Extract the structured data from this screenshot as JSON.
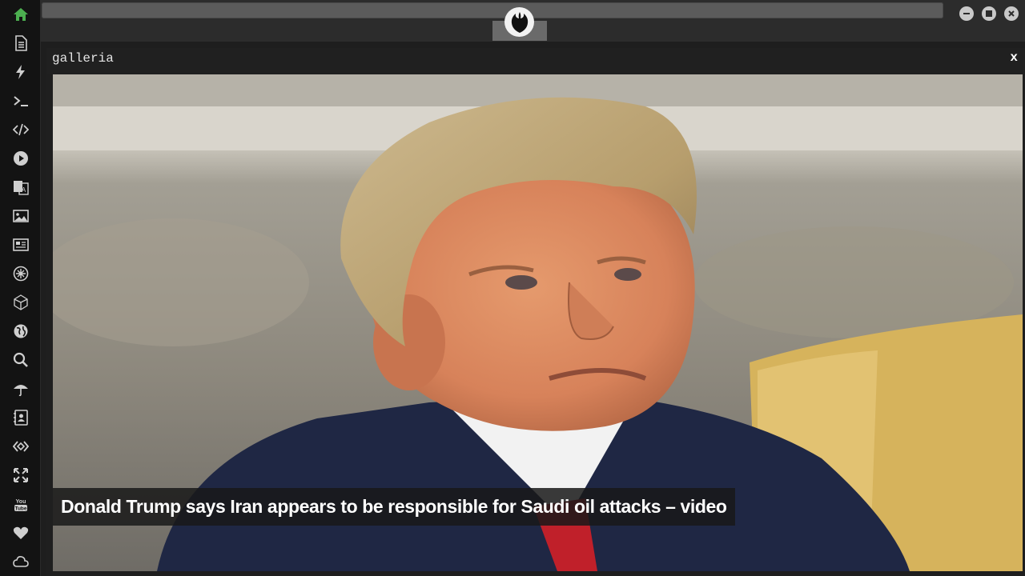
{
  "sidebar": {
    "items": [
      {
        "name": "home-icon",
        "color": "#4caf50"
      },
      {
        "name": "document-icon",
        "color": "#cfcfcf"
      },
      {
        "name": "lightning-icon",
        "color": "#cfcfcf"
      },
      {
        "name": "terminal-icon",
        "color": "#cfcfcf"
      },
      {
        "name": "code-icon",
        "color": "#cfcfcf"
      },
      {
        "name": "play-icon",
        "color": "#cfcfcf"
      },
      {
        "name": "translate-icon",
        "color": "#cfcfcf"
      },
      {
        "name": "image-icon",
        "color": "#cfcfcf"
      },
      {
        "name": "newspaper-icon",
        "color": "#cfcfcf"
      },
      {
        "name": "settings-wheel-icon",
        "color": "#cfcfcf"
      },
      {
        "name": "polyhedron-icon",
        "color": "#cfcfcf"
      },
      {
        "name": "globe-icon",
        "color": "#cfcfcf"
      },
      {
        "name": "search-icon",
        "color": "#cfcfcf"
      },
      {
        "name": "umbrella-icon",
        "color": "#cfcfcf"
      },
      {
        "name": "contacts-icon",
        "color": "#cfcfcf"
      },
      {
        "name": "api-icon",
        "color": "#cfcfcf"
      },
      {
        "name": "expand-icon",
        "color": "#cfcfcf"
      },
      {
        "name": "youtube-icon",
        "color": "#cfcfcf"
      },
      {
        "name": "heart-icon",
        "color": "#cfcfcf"
      },
      {
        "name": "cloud-icon",
        "color": "#cfcfcf"
      }
    ]
  },
  "topbar": {
    "logo_icon": "rebel-alliance-icon",
    "window_controls": [
      "minimize-icon",
      "maximize-icon",
      "close-icon"
    ]
  },
  "panel": {
    "title": "galleria",
    "close_label": "x"
  },
  "gallery": {
    "caption": "Donald Trump says Iran appears to be responsible for Saudi oil attacks – video"
  },
  "colors": {
    "accent": "#4caf50",
    "background": "#1e1e1e",
    "sidebar": "#131313"
  }
}
